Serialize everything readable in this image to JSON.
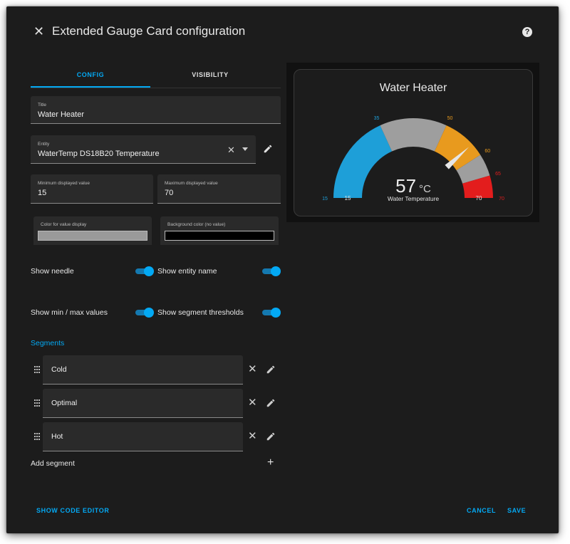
{
  "dialog": {
    "title": "Extended Gauge Card configuration",
    "close_icon": "close-icon",
    "help_icon_glyph": "?"
  },
  "tabs": [
    {
      "label": "CONFIG",
      "active": true
    },
    {
      "label": "VISIBILITY",
      "active": false
    }
  ],
  "form": {
    "title": {
      "label": "Title",
      "value": "Water Heater"
    },
    "entity": {
      "label": "Entity",
      "value": "WaterTemp DS18B20 Temperature"
    },
    "min": {
      "label": "Minimum displayed value",
      "value": "15"
    },
    "max": {
      "label": "Maximum displayed value",
      "value": "70"
    },
    "value_color": {
      "label": "Color for value display",
      "color": "#9a9a9a"
    },
    "bg_color": {
      "label": "Background color (no value)",
      "color": "#000000"
    }
  },
  "toggles": {
    "show_needle": {
      "label": "Show needle",
      "on": true
    },
    "show_entity_name": {
      "label": "Show entity name",
      "on": true
    },
    "show_min_max": {
      "label": "Show min / max values",
      "on": true
    },
    "show_thresholds": {
      "label": "Show segment thresholds",
      "on": true
    }
  },
  "segments": {
    "title": "Segments",
    "items": [
      {
        "label": "Cold"
      },
      {
        "label": "Optimal"
      },
      {
        "label": "Hot"
      }
    ],
    "add_label": "Add segment",
    "add_glyph": "+"
  },
  "footer": {
    "code_editor": "SHOW CODE EDITOR",
    "cancel": "CANCEL",
    "save": "SAVE"
  },
  "preview": {
    "title": "Water Heater",
    "value": "57",
    "unit": "°C",
    "entity_name": "Water Temperature",
    "min_label": "15",
    "max_label": "70",
    "min": 15,
    "max": 70,
    "needle_value": 57,
    "segments": [
      {
        "from": 15,
        "to": 35,
        "color": "#1e9fd8"
      },
      {
        "from": 35,
        "to": 50,
        "color": "#9e9e9e"
      },
      {
        "from": 50,
        "to": 60,
        "color": "#e89a1e"
      },
      {
        "from": 60,
        "to": 65,
        "color": "#9e9e9e"
      },
      {
        "from": 65,
        "to": 70,
        "color": "#e31d1d"
      }
    ],
    "thresholds": [
      {
        "value": 15,
        "label": "15",
        "color": "#1e9fd8"
      },
      {
        "value": 35,
        "label": "35",
        "color": "#1e9fd8"
      },
      {
        "value": 50,
        "label": "50",
        "color": "#e89a1e"
      },
      {
        "value": 60,
        "label": "60",
        "color": "#e89a1e"
      },
      {
        "value": 65,
        "label": "65",
        "color": "#e31d1d"
      },
      {
        "value": 70,
        "label": "70",
        "color": "#e31d1d"
      }
    ]
  },
  "colors": {
    "accent": "#03a9f4",
    "dialog_bg": "#1c1c1c",
    "field_bg": "#2a2a2a"
  }
}
